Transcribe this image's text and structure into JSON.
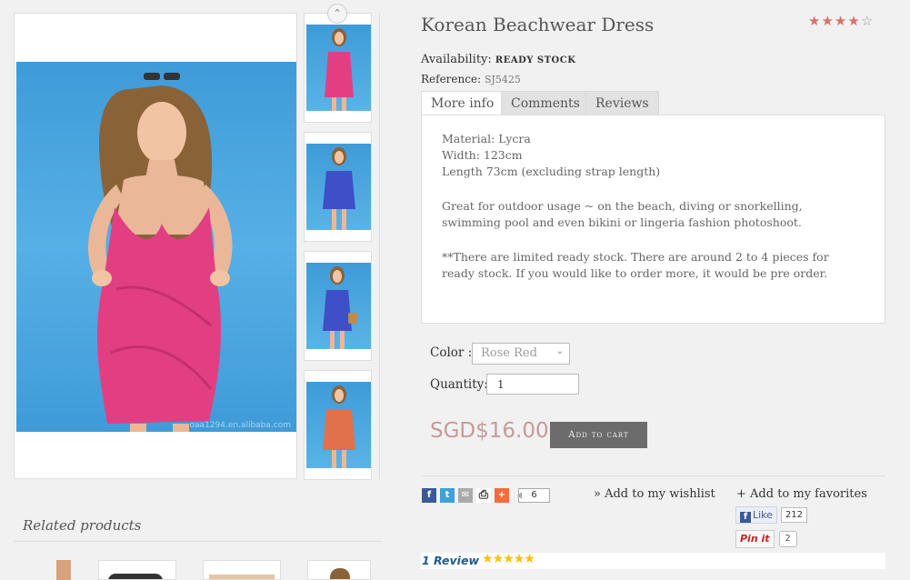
{
  "product": {
    "title": "Korean Beachwear Dress",
    "rating_stars": 4,
    "rating_max": 5,
    "availability_label": "Availability:",
    "availability_value": "READY STOCK",
    "reference_label": "Reference:",
    "reference_value": "SJ5425",
    "watermark": "oaa1294.en.alibaba.com"
  },
  "tabs": [
    {
      "label": "More info",
      "active": true
    },
    {
      "label": "Comments",
      "active": false
    },
    {
      "label": "Reviews",
      "active": false
    }
  ],
  "more_info": {
    "line1": "Material: Lycra",
    "line2": "Width: 123cm",
    "line3": "Length 73cm (excluding strap length)",
    "para2": "Great for outdoor usage ~ on the beach, diving or snorkelling, swimming pool and even bikini or lingeria fashion photoshoot.",
    "para3": "**There are limited ready stock. There are around 2 to 4 pieces for ready stock. If you would like to order more, it would be pre order."
  },
  "options": {
    "color_label": "Color :",
    "color_selected": "Rose Red",
    "quantity_label": "Quantity:",
    "quantity_value": "1"
  },
  "price": "SGD$16.00",
  "add_to_cart_label": "Add to cart",
  "social": {
    "icons": [
      "facebook-icon",
      "twitter-icon",
      "email-icon",
      "print-icon",
      "addthis-plus-icon"
    ],
    "share_count": "6",
    "fb_like_label": "Like",
    "fb_like_count": "212",
    "pin_label": "Pin it",
    "pin_count": "2"
  },
  "links": {
    "wishlist": "» Add to my wishlist",
    "favorites": "+ Add to my favorites"
  },
  "review_summary": {
    "text": "1 Review",
    "stars": 5
  },
  "related": {
    "title": "Related products"
  },
  "colors": {
    "price": "#c59c96",
    "star": "#d9706b",
    "review_star": "#f7c10d",
    "cart_button": "#6c6c6c",
    "dress_pink": "#e23f83",
    "dress_blue": "#3e4fc7",
    "dress_orange": "#e0714d"
  }
}
